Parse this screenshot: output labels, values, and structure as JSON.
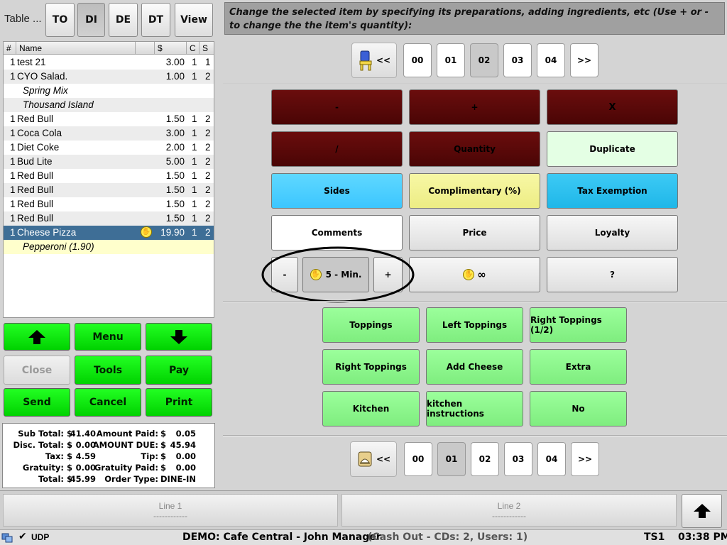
{
  "top_bar": {
    "table_label": "Table ...",
    "order_types": [
      "TO",
      "DI",
      "DE",
      "DT"
    ],
    "selected_order_type": "DI",
    "view_label": "View"
  },
  "instruction": "Change the selected item by specifying its preparations, adding ingredients, etc (Use + or - to change the the item's quantity):",
  "order_list": {
    "headers": [
      "#",
      "Name",
      "$",
      "C",
      "S"
    ],
    "rows": [
      {
        "qty": "1",
        "name": "test 21",
        "price": "3.00",
        "c": "1",
        "s": "1",
        "kind": "item"
      },
      {
        "qty": "1",
        "name": "CYO Salad.",
        "price": "1.00",
        "c": "1",
        "s": "2",
        "kind": "item"
      },
      {
        "qty": "",
        "name": "Spring Mix",
        "price": "",
        "c": "",
        "s": "",
        "kind": "sub"
      },
      {
        "qty": "",
        "name": "Thousand Island",
        "price": "",
        "c": "",
        "s": "",
        "kind": "sub"
      },
      {
        "qty": "1",
        "name": "Red Bull",
        "price": "1.50",
        "c": "1",
        "s": "2",
        "kind": "item"
      },
      {
        "qty": "1",
        "name": "Coca Cola",
        "price": "3.00",
        "c": "1",
        "s": "2",
        "kind": "item"
      },
      {
        "qty": "1",
        "name": "Diet Coke",
        "price": "2.00",
        "c": "1",
        "s": "2",
        "kind": "item"
      },
      {
        "qty": "1",
        "name": "Bud Lite",
        "price": "5.00",
        "c": "1",
        "s": "2",
        "kind": "item"
      },
      {
        "qty": "1",
        "name": "Red Bull",
        "price": "1.50",
        "c": "1",
        "s": "2",
        "kind": "item"
      },
      {
        "qty": "1",
        "name": "Red Bull",
        "price": "1.50",
        "c": "1",
        "s": "2",
        "kind": "item"
      },
      {
        "qty": "1",
        "name": "Red Bull",
        "price": "1.50",
        "c": "1",
        "s": "2",
        "kind": "item"
      },
      {
        "qty": "1",
        "name": "Red Bull",
        "price": "1.50",
        "c": "1",
        "s": "2",
        "kind": "item"
      },
      {
        "qty": "1",
        "name": "Cheese Pizza",
        "price": "19.90",
        "c": "1",
        "s": "2",
        "kind": "selected"
      },
      {
        "qty": "",
        "name": "Pepperoni (1.90)",
        "price": "",
        "c": "",
        "s": "",
        "kind": "modifier"
      }
    ]
  },
  "nav_buttons": {
    "menu": "Menu",
    "close": "Close",
    "tools": "Tools",
    "pay": "Pay",
    "send": "Send",
    "cancel": "Cancel",
    "print": "Print"
  },
  "totals": {
    "sub_total_label": "Sub Total:",
    "sub_total": "41.40",
    "disc_total_label": "Disc. Total:",
    "disc_total": "0.00",
    "tax_label": "Tax:",
    "tax": "4.59",
    "gratuity_label": "Gratuity:",
    "gratuity": "0.00",
    "total_label": "Total:",
    "total": "45.99",
    "amount_paid_label": "Amount Paid:",
    "amount_paid": "0.05",
    "amount_due_label": "AMOUNT DUE:",
    "amount_due": "45.94",
    "tip_label": "Tip:",
    "tip": "0.00",
    "gratuity_paid_label": "Gratuity Paid:",
    "gratuity_paid": "0.00",
    "order_type_label": "Order Type:",
    "order_type": "DINE-IN",
    "currency": "$"
  },
  "seat_pager": {
    "prev": "<<",
    "next": ">>",
    "numbers": [
      "00",
      "01",
      "02",
      "03",
      "04"
    ],
    "selected": "02"
  },
  "course_pager": {
    "prev": "<<",
    "next": ">>",
    "numbers": [
      "00",
      "01",
      "02",
      "03",
      "04"
    ],
    "selected": "01"
  },
  "actions": {
    "minus": "-",
    "plus": "+",
    "delete": "X",
    "divide": "/",
    "quantity": "Quantity",
    "duplicate": "Duplicate",
    "sides": "Sides",
    "complimentary": "Complimentary (%)",
    "tax_exemption": "Tax Exemption",
    "comments": "Comments",
    "price": "Price",
    "loyalty": "Loyalty",
    "timer_minus": "-",
    "timer_value": "5 - Min.",
    "timer_plus": "+",
    "hold_infinite": "∞",
    "question": "?"
  },
  "modifier_groups": [
    "Toppings",
    "Left Toppings",
    "Right Toppings (1/2)",
    "Right Toppings",
    "Add Cheese",
    "Extra",
    "Kitchen",
    "kitchen instructions",
    "No"
  ],
  "lines": {
    "line1": "Line 1",
    "line1_sub": "------------",
    "line2": "Line 2",
    "line2_sub": "------------"
  },
  "status_bar": {
    "udp": "UDP",
    "title_main": "DEMO: Cafe Central - John Manager",
    "title_extra": "(Cash Out - CDs: 2, Users: 1)",
    "terminal": "TS1",
    "time": "03:38 PM"
  },
  "colors": {
    "dark_red": "#5a0808",
    "sky_blue": "#4dd2ff",
    "pale_yellow": "#f4f496",
    "pale_green": "#e4ffe4",
    "green": "#10ee10",
    "light_green": "#8cf58c",
    "selected_row": "#3e6e96"
  }
}
